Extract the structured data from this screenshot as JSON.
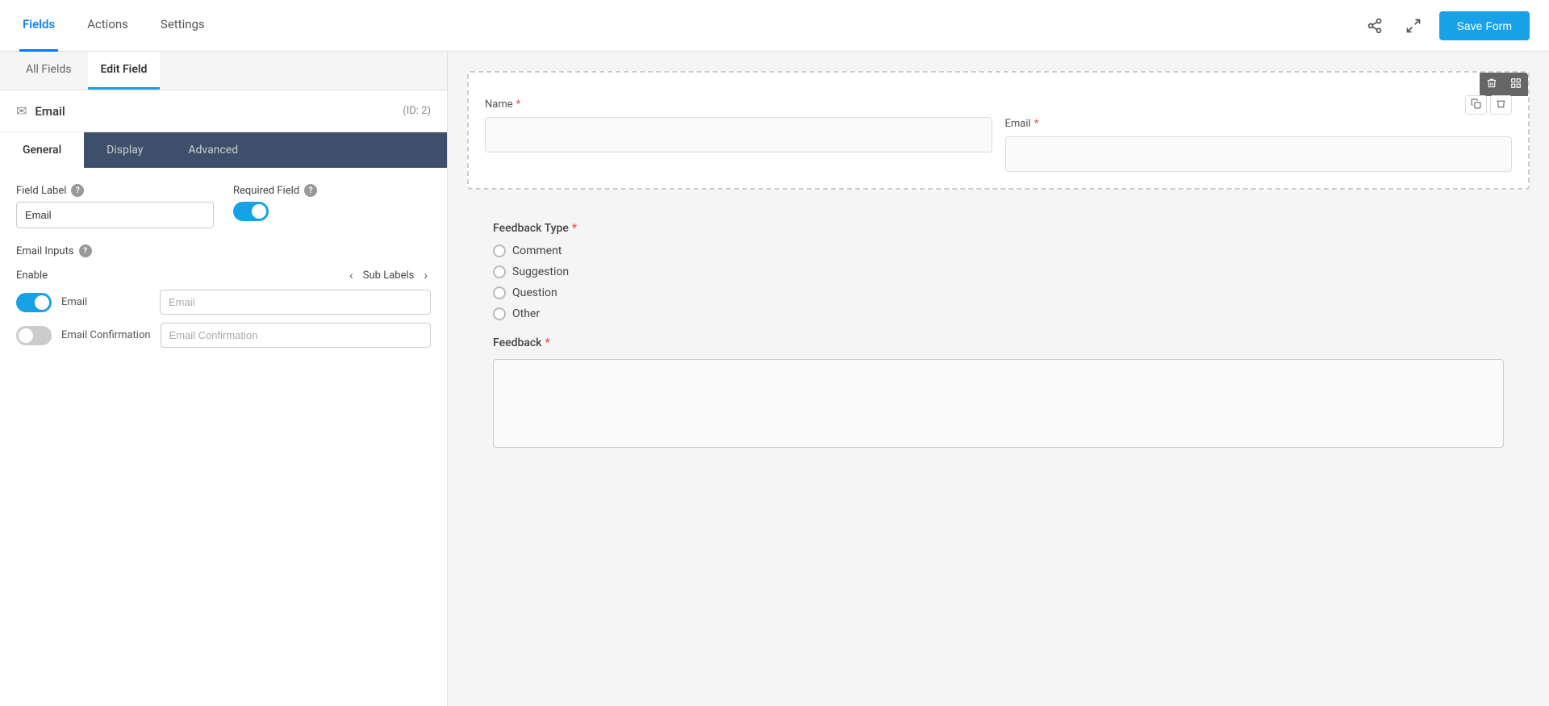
{
  "topNav": {
    "items": [
      {
        "id": "fields",
        "label": "Fields",
        "active": true
      },
      {
        "id": "actions",
        "label": "Actions",
        "active": false
      },
      {
        "id": "settings",
        "label": "Settings",
        "active": false
      }
    ],
    "saveButton": "Save Form"
  },
  "leftPanel": {
    "tabs": [
      {
        "id": "all-fields",
        "label": "All Fields",
        "active": false
      },
      {
        "id": "edit-field",
        "label": "Edit Field",
        "active": true
      }
    ],
    "fieldHeader": {
      "icon": "✉",
      "name": "Email",
      "id": "(ID: 2)"
    },
    "editTabs": [
      {
        "id": "general",
        "label": "General",
        "active": true
      },
      {
        "id": "display",
        "label": "Display",
        "active": false
      },
      {
        "id": "advanced",
        "label": "Advanced",
        "active": false
      }
    ],
    "fieldLabel": {
      "label": "Field Label",
      "value": "Email"
    },
    "requiredField": {
      "label": "Required Field",
      "enabled": true
    },
    "emailInputs": {
      "label": "Email Inputs",
      "subLabelsTitle": "Sub Labels",
      "rows": [
        {
          "id": "email",
          "enabled": true,
          "name": "Email",
          "subLabel": "Email"
        },
        {
          "id": "email-confirmation",
          "enabled": false,
          "name": "Email Confirmation",
          "subLabel": "Email Confirmation"
        }
      ]
    }
  },
  "rightPanel": {
    "formFields": [
      {
        "label": "Name",
        "required": true
      },
      {
        "label": "Email",
        "required": true
      }
    ],
    "feedbackType": {
      "label": "Feedback Type",
      "required": true,
      "options": [
        "Comment",
        "Suggestion",
        "Question",
        "Other"
      ]
    },
    "feedback": {
      "label": "Feedback",
      "required": true
    }
  },
  "icons": {
    "share": "⎆",
    "fullscreen": "⛶",
    "delete": "🗑",
    "grid": "⊞",
    "copy": "⧉",
    "trash": "🗑",
    "chevronLeft": "‹",
    "chevronRight": "›",
    "question": "?"
  }
}
